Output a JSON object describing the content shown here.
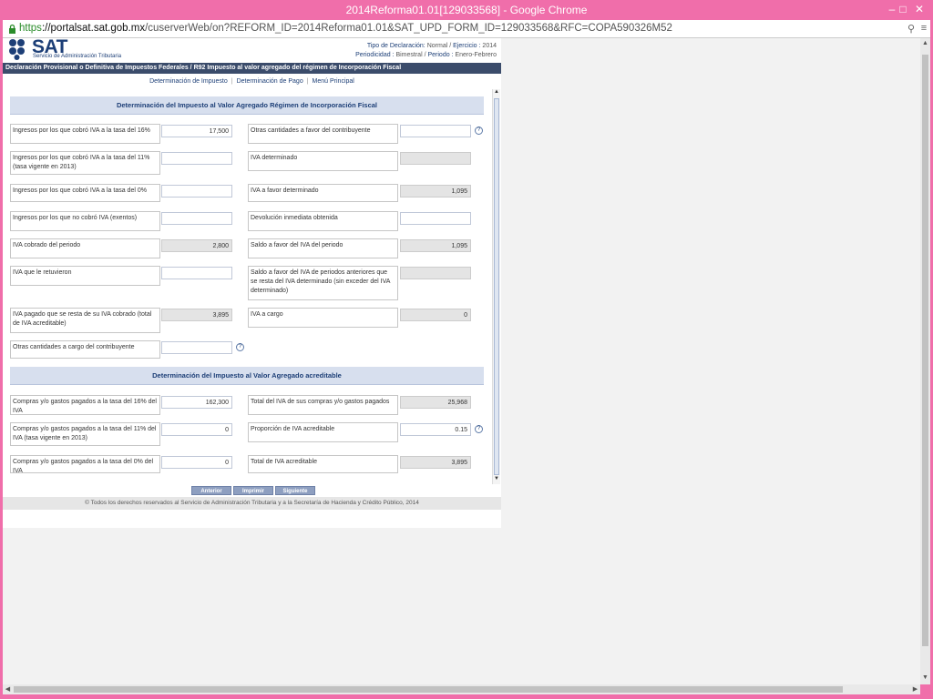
{
  "window": {
    "title": "2014Reforma01.01[129033568] - Google Chrome"
  },
  "address": {
    "https": "https",
    "domain": "://portalsat.sat.gob.mx",
    "path": "/cuserverWeb/on?REFORM_ID=2014Reforma01.01&SAT_UPD_FORM_ID=129033568&RFC=COPA590326M52"
  },
  "header": {
    "logo_text": "SAT",
    "logo_sub": "Servicio de Administración Tributaria",
    "tipo_label": "Tipo de Declaración:",
    "tipo_value": "Normal",
    "ejercicio_label": "Ejercicio :",
    "ejercicio_value": "2014",
    "periodicidad_label": "Periodicidad :",
    "periodicidad_value": "Bimestral",
    "periodo_label": "Periodo :",
    "periodo_value": "Enero-Febrero",
    "banner": "Declaración Provisional o Definitiva de Impuestos Federales / R92 Impuesto al valor agregado del régimen de Incorporación Fiscal"
  },
  "nav": {
    "link1": "Determinación de Impuesto",
    "sep": "|",
    "link2": "Determinación de Pago",
    "link3": "Menú Principal"
  },
  "section1": {
    "title": "Determinación del Impuesto al Valor Agregado Régimen de Incorporación Fiscal",
    "left": [
      {
        "label": "Ingresos por los que cobró IVA a la tasa del 16%",
        "value": "17,500",
        "readonly": false
      },
      {
        "label": "Ingresos por los que cobró IVA a la tasa del 11% (tasa vigente en 2013)",
        "value": "",
        "readonly": false
      },
      {
        "label": "Ingresos por los que cobró IVA a la tasa del 0%",
        "value": "",
        "readonly": false
      },
      {
        "label": "Ingresos por los que no cobró IVA (exentos)",
        "value": "",
        "readonly": false
      },
      {
        "label": "IVA cobrado del periodo",
        "value": "2,800",
        "readonly": true
      },
      {
        "label": "IVA que le retuvieron",
        "value": "",
        "readonly": false
      },
      {
        "label": "IVA pagado que se resta de su IVA cobrado (total de IVA acreditable)",
        "value": "3,895",
        "readonly": true
      },
      {
        "label": "Otras cantidades a cargo del contribuyente",
        "value": "",
        "readonly": false
      }
    ],
    "right": [
      {
        "label": "Otras cantidades a favor del contribuyente",
        "value": "",
        "readonly": false
      },
      {
        "label": "IVA determinado",
        "value": "",
        "readonly": true
      },
      {
        "label": "IVA a favor determinado",
        "value": "1,095",
        "readonly": true
      },
      {
        "label": "Devolución inmediata obtenida",
        "value": "",
        "readonly": false
      },
      {
        "label": "Saldo a favor del IVA del periodo",
        "value": "1,095",
        "readonly": true
      },
      {
        "label": "Saldo a favor del IVA de periodos anteriores que se resta del IVA determinado (sin exceder del IVA determinado)",
        "value": "",
        "readonly": true
      },
      {
        "label": "IVA a cargo",
        "value": "0",
        "readonly": true
      }
    ]
  },
  "section2": {
    "title": "Determinación del Impuesto al Valor Agregado acreditable",
    "left": [
      {
        "label": "Compras y/o gastos pagados a la tasa del 16% del IVA",
        "value": "162,300",
        "readonly": false
      },
      {
        "label": "Compras y/o gastos pagados a la tasa del 11% del IVA (tasa vigente en 2013)",
        "value": "0",
        "readonly": false
      },
      {
        "label": "Compras y/o gastos pagados a la tasa del 0% del IVA",
        "value": "0",
        "readonly": false
      }
    ],
    "right": [
      {
        "label": "Total del IVA de sus compras y/o gastos pagados",
        "value": "25,968",
        "readonly": true
      },
      {
        "label": "Proporción de IVA acreditable",
        "value": "0.15",
        "readonly": false
      },
      {
        "label": "Total de IVA acreditable",
        "value": "3,895",
        "readonly": true
      }
    ]
  },
  "help_glyph": "?",
  "buttons": {
    "prev": "Anterior",
    "print": "Imprimir",
    "next": "Siguiente"
  },
  "footer": "© Todos los derechos reservados al Servicio de Administración Tributaria y a la Secretaría de Hacienda y Crédito Público, 2014",
  "colors": {
    "chrome": "#f06eaa",
    "banner": "#3b4c6b",
    "section": "#d7dfee",
    "brand": "#1d3f77"
  }
}
